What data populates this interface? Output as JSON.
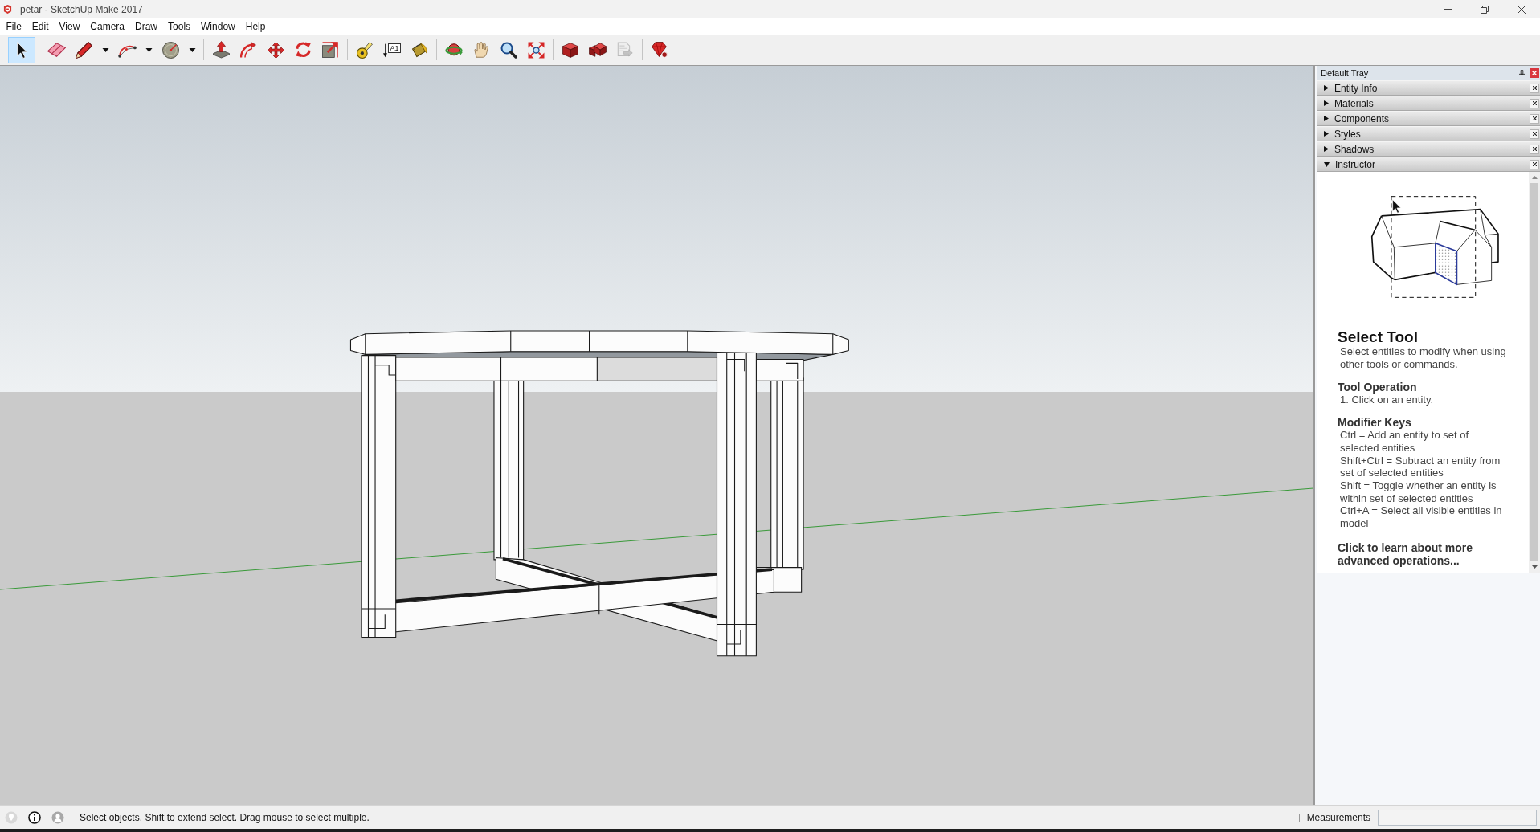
{
  "window": {
    "title": "petar - SketchUp Make 2017"
  },
  "menu": [
    "File",
    "Edit",
    "View",
    "Camera",
    "Draw",
    "Tools",
    "Window",
    "Help"
  ],
  "toolbar": {
    "groups": [
      [
        {
          "selected": true,
          "disabled": false,
          "dropdown": false
        }
      ],
      [
        {
          "selected": false,
          "disabled": false,
          "dropdown": false
        },
        {
          "selected": false,
          "disabled": false,
          "dropdown": true
        },
        {
          "selected": false,
          "disabled": false,
          "dropdown": true
        },
        {
          "selected": false,
          "disabled": false,
          "dropdown": true
        }
      ],
      [
        {
          "selected": false,
          "disabled": false,
          "dropdown": false
        },
        {
          "selected": false,
          "disabled": false,
          "dropdown": false
        },
        {
          "selected": false,
          "disabled": false,
          "dropdown": false
        },
        {
          "selected": false,
          "disabled": false,
          "dropdown": false
        },
        {
          "selected": false,
          "disabled": false,
          "dropdown": false
        }
      ],
      [
        {
          "selected": false,
          "disabled": false,
          "dropdown": false
        },
        {
          "selected": false,
          "disabled": false,
          "dropdown": false,
          "label": "A1"
        },
        {
          "selected": false,
          "disabled": false,
          "dropdown": false
        }
      ],
      [
        {
          "selected": false,
          "disabled": false,
          "dropdown": false
        },
        {
          "selected": false,
          "disabled": false,
          "dropdown": false
        },
        {
          "selected": false,
          "disabled": false,
          "dropdown": false
        },
        {
          "selected": false,
          "disabled": false,
          "dropdown": false
        }
      ],
      [
        {
          "selected": false,
          "disabled": false,
          "dropdown": false
        },
        {
          "selected": false,
          "disabled": false,
          "dropdown": false
        },
        {
          "selected": false,
          "disabled": true,
          "dropdown": false
        }
      ],
      [
        {
          "selected": false,
          "disabled": false,
          "dropdown": false
        }
      ]
    ]
  },
  "tray": {
    "title": "Default Tray",
    "panels": [
      {
        "label": "Entity Info",
        "expanded": false
      },
      {
        "label": "Materials",
        "expanded": false
      },
      {
        "label": "Components",
        "expanded": false
      },
      {
        "label": "Styles",
        "expanded": false
      },
      {
        "label": "Shadows",
        "expanded": false
      },
      {
        "label": "Instructor",
        "expanded": true,
        "instructor": {
          "title": "Select Tool",
          "description": "Select entities to modify when using other tools or commands.",
          "sections": [
            {
              "heading": "Tool Operation",
              "lines": [
                "1. Click on an entity."
              ]
            },
            {
              "heading": "Modifier Keys",
              "lines": [
                "Ctrl = Add an entity to set of selected entities",
                "Shift+Ctrl = Subtract an entity from set of selected entities",
                "Shift = Toggle whether an entity is within set of selected entities",
                "Ctrl+A = Select all visible entities in model"
              ]
            }
          ],
          "link": "Click to learn about more advanced operations..."
        }
      }
    ]
  },
  "status_bar": {
    "message": "Select objects. Shift to extend select. Drag mouse to select multiple.",
    "measurements_label": "Measurements"
  }
}
